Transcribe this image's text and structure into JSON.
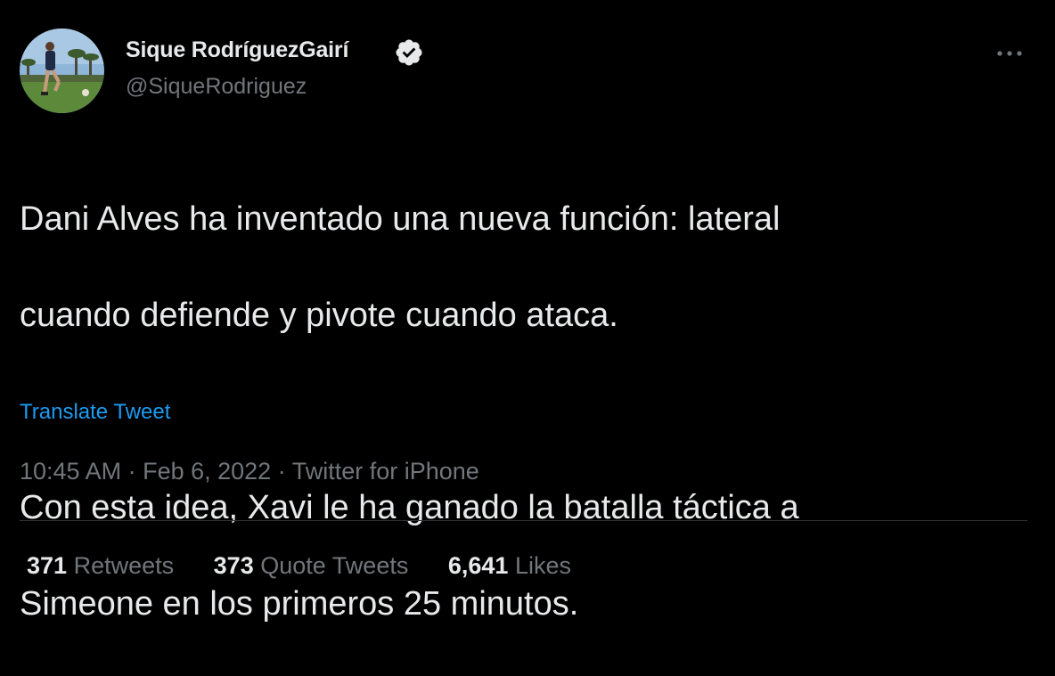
{
  "author": {
    "display_name": "Sique RodríguezGairí",
    "handle": "@SiqueRodriguez",
    "verified": true
  },
  "icons": {
    "verified": "verified-badge-icon",
    "more": "more-dots-icon",
    "avatar": "avatar-photo"
  },
  "tweet": {
    "paragraph1_line1": "Dani Alves ha inventado una nueva función: lateral",
    "paragraph1_line2": "cuando defiende y pivote cuando ataca.",
    "paragraph2_line1": "Con esta idea, Xavi le ha ganado la batalla táctica a",
    "paragraph2_line2": "Simeone en los primeros 25 minutos.",
    "translate_label": "Translate Tweet"
  },
  "meta": {
    "time": "10:45 AM",
    "separator": " · ",
    "date": "Feb 6, 2022",
    "source": "Twitter for iPhone"
  },
  "stats": {
    "retweets_count": "371",
    "retweets_label": "Retweets",
    "quotes_count": "373",
    "quotes_label": "Quote Tweets",
    "likes_count": "6,641",
    "likes_label": "Likes"
  },
  "colors": {
    "background": "#000000",
    "text_primary": "#e7e9ea",
    "text_secondary": "#71767b",
    "link": "#1d9bf0",
    "divider": "#2f3336"
  }
}
